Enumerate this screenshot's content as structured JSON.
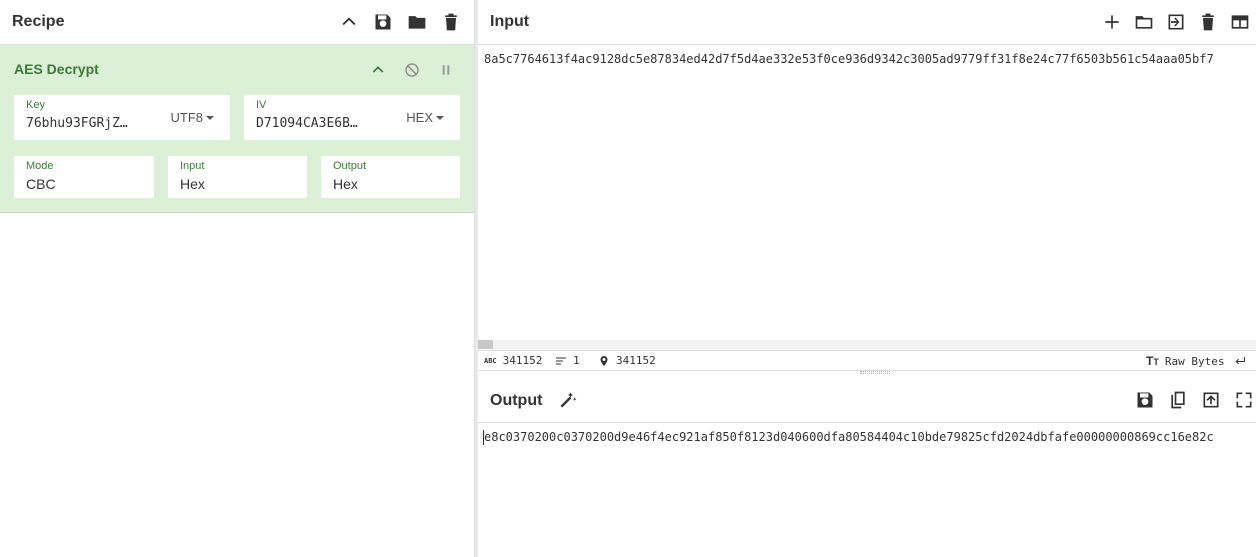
{
  "recipe": {
    "title": "Recipe",
    "icons": [
      "chevron-up-icon",
      "save-icon",
      "folder-icon",
      "trash-icon"
    ]
  },
  "operation": {
    "name": "AES Decrypt",
    "key": {
      "label": "Key",
      "value": "76bhu93FGRjZ…",
      "encoding": "UTF8"
    },
    "iv": {
      "label": "IV",
      "value": "D71094CA3E6B…",
      "encoding": "HEX"
    },
    "mode": {
      "label": "Mode",
      "value": "CBC"
    },
    "input": {
      "label": "Input",
      "value": "Hex"
    },
    "output": {
      "label": "Output",
      "value": "Hex"
    }
  },
  "input_pane": {
    "title": "Input",
    "text": "8a5c7764613f4ac9128dc5e87834ed42d7f5d4ae332e53f0ce936d9342c3005ad9779ff31f8e24c77f6503b561c54aaa05bf7",
    "stats": {
      "length": "341152",
      "lines": "1",
      "position": "341152"
    },
    "raw_bytes_label": "Raw Bytes"
  },
  "output_pane": {
    "title": "Output",
    "text": "e8c0370200c0370200d9e46f4ec921af850f8123d040600dfa80584404c10bde79825cfd2024dbfafe00000000869cc16e82c"
  },
  "colors": {
    "accent_green": "#3d7a3a",
    "op_bg": "#dcf0d8"
  }
}
